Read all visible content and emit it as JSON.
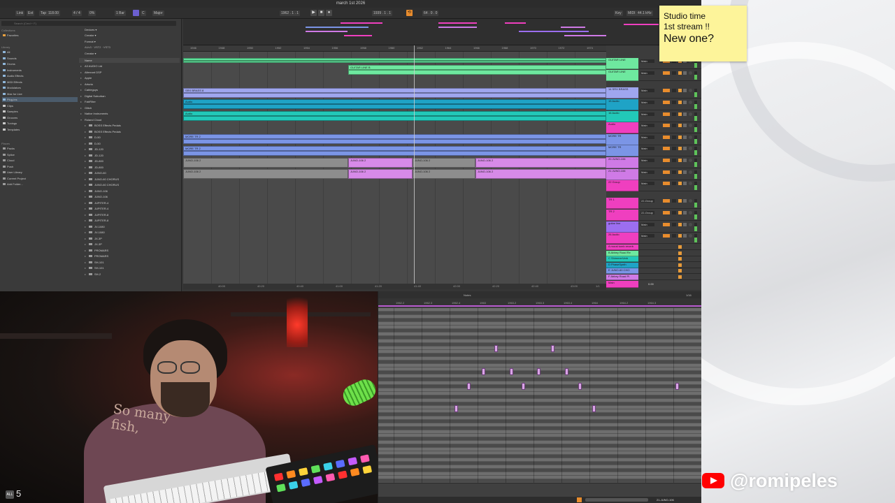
{
  "window": {
    "title": "march 1st 2026"
  },
  "transport": {
    "link": "Link",
    "ext": "Ext",
    "tap": "Tap",
    "tempo": "118.00",
    "signature": "4 / 4",
    "cpu": "0%",
    "bar": "1 Bar",
    "key": "C",
    "scale": "Major",
    "position": "1962 . 1 . 1",
    "loop_start": "1939 . 1 . 1",
    "loop_length": "64 . 0 . 0",
    "key_label": "Key",
    "midi_label": "MIDI",
    "sample_rate": "44.1 kHz"
  },
  "browser": {
    "search_placeholder": "Search (Cmd + F)",
    "collections_label": "Collections",
    "favorites": "Favorites",
    "library_label": "Library",
    "categories": [
      "All",
      "Sounds",
      "Drums",
      "Instruments",
      "Audio Effects",
      "MIDI Effects",
      "Modulators",
      "Max for Live",
      "Plug-ins",
      "Clips",
      "Samples",
      "Grooves",
      "Tunings",
      "Templates"
    ],
    "places_label": "Places",
    "places": [
      "Packs",
      "Splice",
      "Cloud",
      "Push",
      "User Library",
      "Current Project",
      "Add Folder..."
    ],
    "filters": [
      "Devices ▾",
      "Creator ▾",
      "Format ▾",
      "AUv3 · VST2 · VST3",
      "Creator ▾"
    ],
    "column_header": "Name",
    "folders": [
      "A3 AUDIO Ltd",
      "Alterrant DSP",
      "Apple",
      "Arturia",
      "Cableguys",
      "Digital Suburban",
      "FabFilter",
      "Glitch",
      "Native Instruments",
      "Roland Cloud"
    ],
    "roland_items": [
      "BOSS Effects Pedals",
      "BOSS Effects Pedals",
      "D-50",
      "D-50",
      "JD-120",
      "JD-120",
      "JD-800",
      "JD-800",
      "JUNO-60",
      "JUNO-60 CHORUS",
      "JUNO-60 CHORUS",
      "JUNO-106",
      "JUNO-106",
      "JUPITER-4",
      "JUPITER-4",
      "JUPITER-8",
      "JUPITER-8",
      "JV-1080",
      "JV-1080",
      "JX-3P",
      "JX-3P",
      "PROMARS",
      "PROMARS",
      "SH-101",
      "SH-101",
      "SH-2"
    ]
  },
  "arrangement": {
    "ruler_ticks": [
      "1946",
      "1948",
      "1950",
      "1952",
      "1954",
      "1956",
      "1958",
      "1960",
      "1962",
      "1964",
      "1966",
      "1968",
      "1970",
      "1972",
      "1974"
    ],
    "time_ticks": [
      "40:00",
      "40:20",
      "40:40",
      "41:00",
      "41:20",
      "41:40",
      "42:00",
      "42:20",
      "42:40",
      "43:00"
    ],
    "zoom": "1/1",
    "clip_labels": {
      "guitar": "GUITAR LINE B",
      "guitar2": "GUITAR LINE 15",
      "brass": "SRX BRASS 8",
      "audio": "Audio",
      "more": "MORE TR 2",
      "juno": "JUNO-106 2"
    }
  },
  "tracks": [
    {
      "name": "GUITAR LINE",
      "color": "#6ee89f",
      "route": "Main"
    },
    {
      "name": "GUITAR LINE",
      "color": "#6ee89f",
      "route": "Main"
    },
    {
      "name": "14 SRX BRASS",
      "color": "#9fa6ef",
      "route": "Main"
    },
    {
      "name": "15 Audio",
      "color": "#1fa3c6",
      "route": "Main"
    },
    {
      "name": "16 Audio",
      "color": "#22c8b8",
      "route": "Main"
    },
    {
      "name": "Audio",
      "color": "#ef3fbf",
      "route": "Main"
    },
    {
      "name": "MORE TR",
      "color": "#7b95e6",
      "route": "Main"
    },
    {
      "name": "MORE TR",
      "color": "#7b95e6",
      "route": "Main"
    },
    {
      "name": "20 JUNO-106",
      "color": "#cf7ae6",
      "route": "Main"
    },
    {
      "name": "21 JUNO-106",
      "color": "#cf7ae6",
      "route": "Main"
    },
    {
      "name": "22 Group",
      "color": "#ef3fbf",
      "route": "Main"
    },
    {
      "name": "TR 1",
      "color": "#ef3fbf",
      "route": "22-Group"
    },
    {
      "name": "TR 2",
      "color": "#ef3fbf",
      "route": "22-Group"
    },
    {
      "name": "guitar line",
      "color": "#9c6ef0",
      "route": "Main"
    },
    {
      "name": "26 Audio",
      "color": "#ef3fbf",
      "route": "Main"
    }
  ],
  "returns": [
    "A moral tomb reverb",
    "B Abbey Road Re",
    "C ShimmerVerb",
    "D PhaseSynth",
    "E JUNO-60 CHO",
    "F Abbey Road Pl"
  ],
  "master": {
    "name": "Main",
    "volume": "0.00"
  },
  "midi_editor": {
    "label": "Notes",
    "ruler_ticks": [
      "1962.2",
      "1962.3",
      "1962.4",
      "1963",
      "1963.2",
      "1963.3",
      "1963.4",
      "1964",
      "1964.2",
      "1964.3"
    ],
    "grid": "1/16",
    "clip_name": "21-JUNO-106"
  },
  "sticky_note": {
    "line1": "Studio time",
    "line2": "1st stream !!",
    "line3": "New one?"
  },
  "webcam": {
    "sweater_text": "So many fish,",
    "badge": "5",
    "badge_icon": "ALL"
  },
  "watermark": {
    "handle": "@romipeles"
  },
  "colors": {
    "accent": "#e88c2d",
    "note": "#d9a4e6",
    "youtube": "#ff0000",
    "sticky": "#fdf49a"
  }
}
